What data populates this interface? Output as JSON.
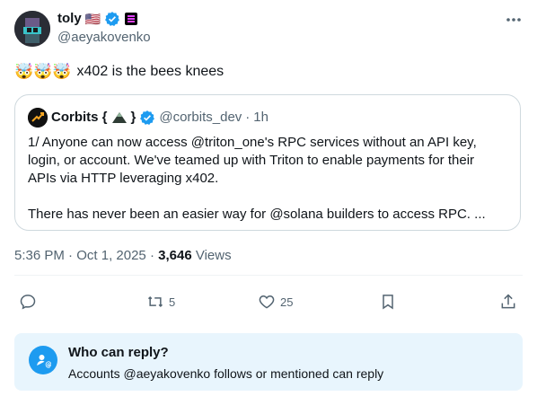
{
  "author": {
    "name": "toly",
    "handle": "@aeyakovenko",
    "flag_emoji": "🇺🇸"
  },
  "tweet": {
    "emojis": "🤯🤯🤯",
    "text": "x402 is the bees knees"
  },
  "quote": {
    "name": "Corbits {",
    "name_suffix": "}",
    "handle": "@corbits_dev",
    "dot": "·",
    "time": "1h",
    "line1": "1/ Anyone can now access @triton_one's RPC services without an API key, login, or account.  We've teamed up with Triton to enable payments for their APIs via HTTP leveraging x402.",
    "line2": "There has never been an easier way for @solana builders to access RPC. ..."
  },
  "meta": {
    "time": "5:36 PM",
    "dot1": "·",
    "date": "Oct 1, 2025",
    "dot2": "·",
    "views_count": "3,646",
    "views_label": "Views"
  },
  "actions": {
    "retweets": "5",
    "likes": "25"
  },
  "reply_restriction": {
    "title": "Who can reply?",
    "subtitle": "Accounts @aeyakovenko follows or mentioned can reply"
  },
  "colors": {
    "accent": "#1d9bf0",
    "muted": "#536471",
    "border": "#cfd9de"
  }
}
